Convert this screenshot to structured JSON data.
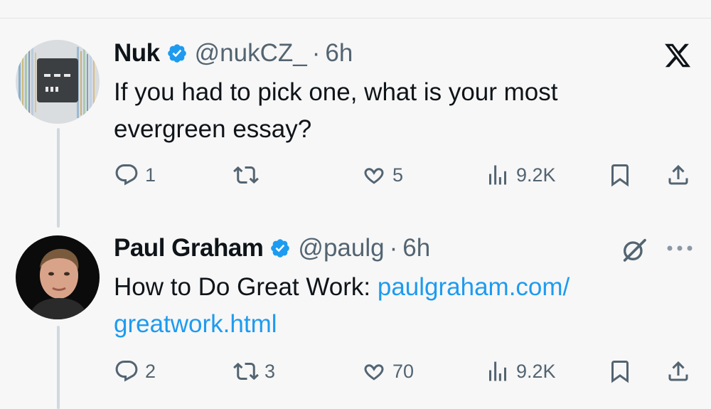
{
  "tweets": [
    {
      "name": "Nuk",
      "handle": "@nukCZ_",
      "separator": "·",
      "time": "6h",
      "text": "If you had to pick one, what is your most evergreen essay?",
      "actions": {
        "replies": "1",
        "reposts": "",
        "likes": "5",
        "views": "9.2K"
      }
    },
    {
      "name": "Paul Graham",
      "handle": "@paulg",
      "separator": "·",
      "time": "6h",
      "text": "How to Do Great Work: ",
      "link_line1": "paulgraham.com/",
      "link_line2": "greatwork.html",
      "actions": {
        "replies": "2",
        "reposts": "3",
        "likes": "70",
        "views": "9.2K"
      }
    }
  ],
  "icons": [
    "x-logo-icon",
    "verified-badge-icon",
    "reply-icon",
    "repost-icon",
    "like-icon",
    "views-icon",
    "bookmark-icon",
    "share-icon",
    "grok-icon",
    "more-icon"
  ],
  "colors": {
    "link": "#1d9bf0",
    "verified": "#1d9bf0",
    "muted": "#536471",
    "background": "#f7f7f7"
  }
}
